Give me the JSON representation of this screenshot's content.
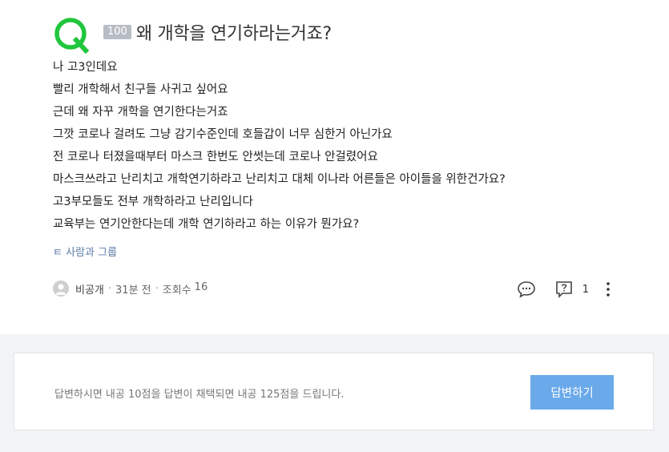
{
  "question": {
    "points": "100",
    "title": "왜 개학을 연기하라는거죠?",
    "body_lines": [
      "나 고3인데요",
      "빨리 개학해서 친구들 사귀고 싶어요",
      "근데 왜 자꾸 개학을 연기한다는거죠",
      "그깟 코로나 걸려도 그냥 감기수준인데 호들갑이 너무 심한거 아닌가요",
      "전 코로나 터졌을때부터 마스크 한번도 안썻는데 코로나 안걸렸어요",
      "마스크쓰라고 난리치고 개학연기하라고 난리치고 대체 이나라 어른들은 아이들을 위한건가요?",
      "고3부모들도 전부 개학하라고 난리입니다",
      "교육부는 연기안한다는데 개학 연기하라고 하는 이유가 뭔가요?"
    ],
    "tag_link": "ㅌ 사람과 그룹",
    "author": "비공개",
    "time_ago": "31분 전",
    "views_label": "조회수",
    "views": "16",
    "report_count": "1"
  },
  "answer_prompt": {
    "text": "답변하시면 내공 10점을 답변이 채택되면 내공 125점을 드립니다.",
    "button_label": "답변하기"
  },
  "colors": {
    "logo_green": "#20c63c",
    "badge_gray": "#b8bcc4",
    "button_blue": "#6aa9ea",
    "link_blue": "#5b7ba8",
    "footer_bg": "#f2f3f5"
  },
  "icons": [
    "q-logo-icon",
    "avatar-icon",
    "comment-icon",
    "report-icon",
    "more-vertical-icon"
  ]
}
